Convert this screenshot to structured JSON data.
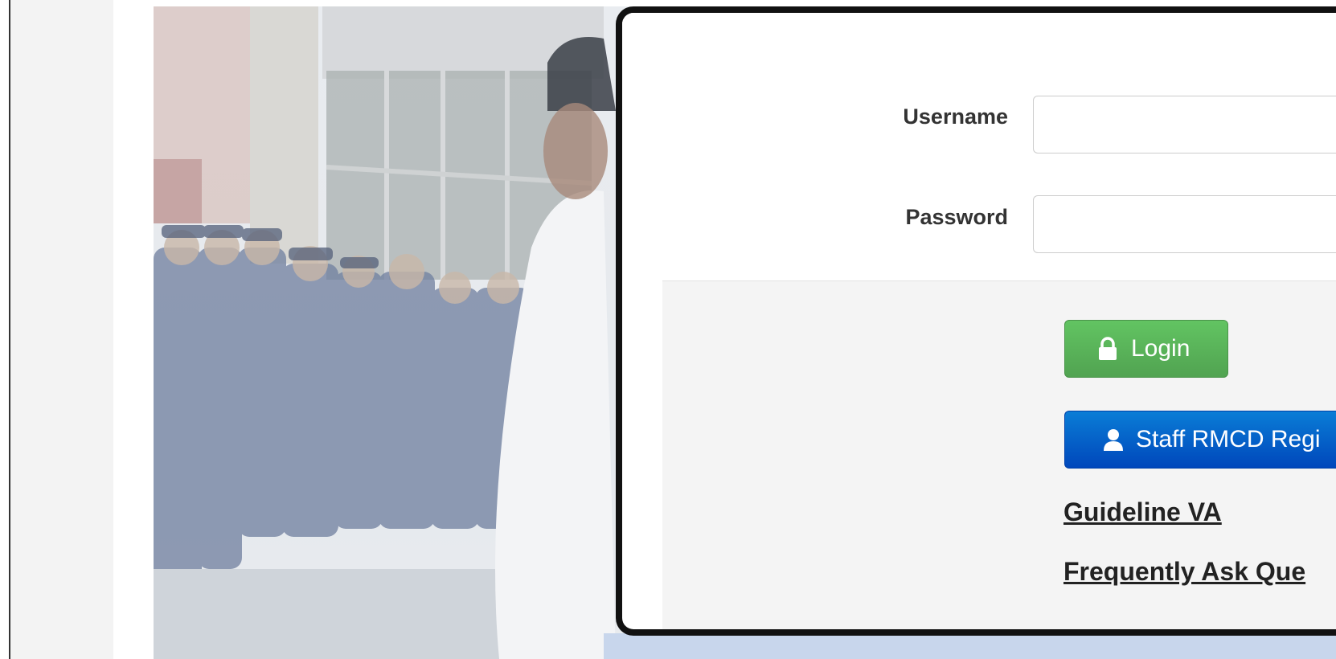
{
  "login": {
    "username_label": "Username",
    "password_label": "Password",
    "username_value": "",
    "password_value": "",
    "login_button": "Login",
    "register_button": "Staff RMCD Regi",
    "guideline_link": "Guideline VA",
    "faq_link": "Frequently Ask Que"
  },
  "icons": {
    "login_icon": "lock-icon",
    "register_icon": "user-icon"
  },
  "colors": {
    "login_button": "#5bb75b",
    "register_button": "#0059c9",
    "card_border": "#111111",
    "card_footer": "#f4f4f4"
  }
}
